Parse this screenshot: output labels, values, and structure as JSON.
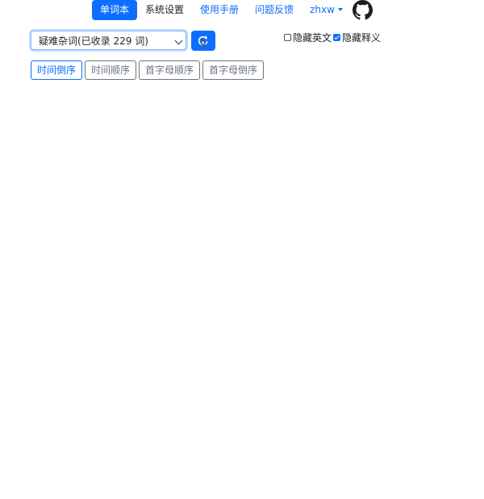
{
  "nav": {
    "items": [
      {
        "label": "单词本"
      },
      {
        "label": "系统设置"
      },
      {
        "label": "使用手册"
      },
      {
        "label": "问题反馈"
      },
      {
        "label": "zhxw"
      }
    ],
    "github_icon": "github-icon"
  },
  "wordbook_select": {
    "selected": "疑难杂词(已收录 229 词)"
  },
  "refresh_button": {
    "icon": "refresh-icon"
  },
  "toggles": {
    "hide_english": {
      "label": "隐藏英文",
      "checked": false
    },
    "hide_meaning": {
      "label": "隐藏释义",
      "checked": true
    }
  },
  "sort_buttons": [
    {
      "label": "时间倒序",
      "active": true
    },
    {
      "label": "时间顺序",
      "active": false
    },
    {
      "label": "首字母顺序",
      "active": false
    },
    {
      "label": "首字母倒序",
      "active": false
    }
  ],
  "colors": {
    "primary": "#0d6efd",
    "secondary": "#6c757d"
  }
}
